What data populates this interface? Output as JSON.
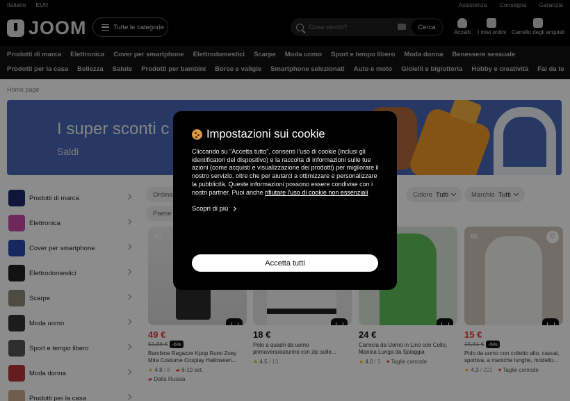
{
  "topbar": {
    "language": "Italiano",
    "currency": "EUR",
    "assistance": "Assistenza",
    "delivery": "Consegna",
    "warranty": "Garanzia"
  },
  "header": {
    "logo": "JOOM",
    "categories_button": "Tutte le categorie",
    "search_placeholder": "Cosa cerchi?",
    "search_button": "Cerca",
    "login": "Accedi",
    "orders": "I miei ordini",
    "cart": "Carrello degli acquisti"
  },
  "nav": {
    "row1": [
      "Prodotti di marca",
      "Elettronica",
      "Cover per smartphone",
      "Elettrodomestici",
      "Scarpe",
      "Moda uomo",
      "Sport e tempo libero",
      "Moda donna",
      "Benessere sessuale"
    ],
    "row2": [
      "Prodotti per la casa",
      "Bellezza",
      "Salute",
      "Prodotti per bambini",
      "Borse e valigie",
      "Smartphone selezionati",
      "Auto e moto",
      "Gioielli e bigiotteria",
      "Hobby e creatività",
      "Fai da te"
    ]
  },
  "breadcrumb": "Home page",
  "banner": {
    "title": "I super sconti c",
    "subtitle": "Saldi"
  },
  "sidebar": [
    "Prodotti di marca",
    "Elettronica",
    "Cover per smartphone",
    "Elettrodomestici",
    "Scarpe",
    "Moda uomo",
    "Sport e tempo libero",
    "Moda donna",
    "Prodotti per la casa"
  ],
  "filters": {
    "sort": "Ordina",
    "country": "Paese",
    "color_label": "Colore",
    "color_value": "Tutti",
    "brand_label": "Marchio",
    "brand_value": "Tutti"
  },
  "products": [
    {
      "price": "49 €",
      "old": "51,86 €",
      "disc": "-6%",
      "name": "Bambine Ragazze Kpop Rumi Zoey Mira Costume Cosplay Halloween...",
      "rating": "4.8",
      "reviews": "8",
      "ship": "6-10 set.",
      "origin": "Dalla Russia",
      "ad": "AD"
    },
    {
      "price": "18 €",
      "name": "Polo a quadri da uomo primavera/autunno con zip sulle...",
      "rating": "4.5",
      "reviews": "13"
    },
    {
      "price": "24 €",
      "name": "Camicia da Uomo in Lino con Collo, Manica Lunga da Spiaggia",
      "rating": "4.0",
      "reviews": "5",
      "tag": "Taglie comode"
    },
    {
      "price": "15 €",
      "old": "15,81 €",
      "disc": "-5%",
      "name": "Polo da uomo con colletto alto, casual, sportiva, a maniche lunghe, modello...",
      "rating": "4.3",
      "reviews": "222",
      "tag": "Taglie comode",
      "ad": "AD"
    }
  ],
  "cookie_modal": {
    "title": "Impostazioni sui cookie",
    "body": "Cliccando su \"Accetta tutto\", consenti l'uso di cookie (inclusi gli identificatori del dispositivo) e la raccolta di informazioni sulle tue azioni (come acquisti e visualizzazione dei prodotti) per migliorare il nostro servizio, oltre che per aiutarci a ottimizzare e personalizzare la pubblicità. Queste informazioni possono essere condivise con i nostri partner. Puoi anche ",
    "reject_link": "rifiutare l'uso di cookie non essenziali",
    "more": "Scopri di più",
    "accept": "Accetta tutti"
  },
  "colors": {
    "sale": "#e23a3a",
    "banner": "#4667b4",
    "modal": "#000000"
  }
}
